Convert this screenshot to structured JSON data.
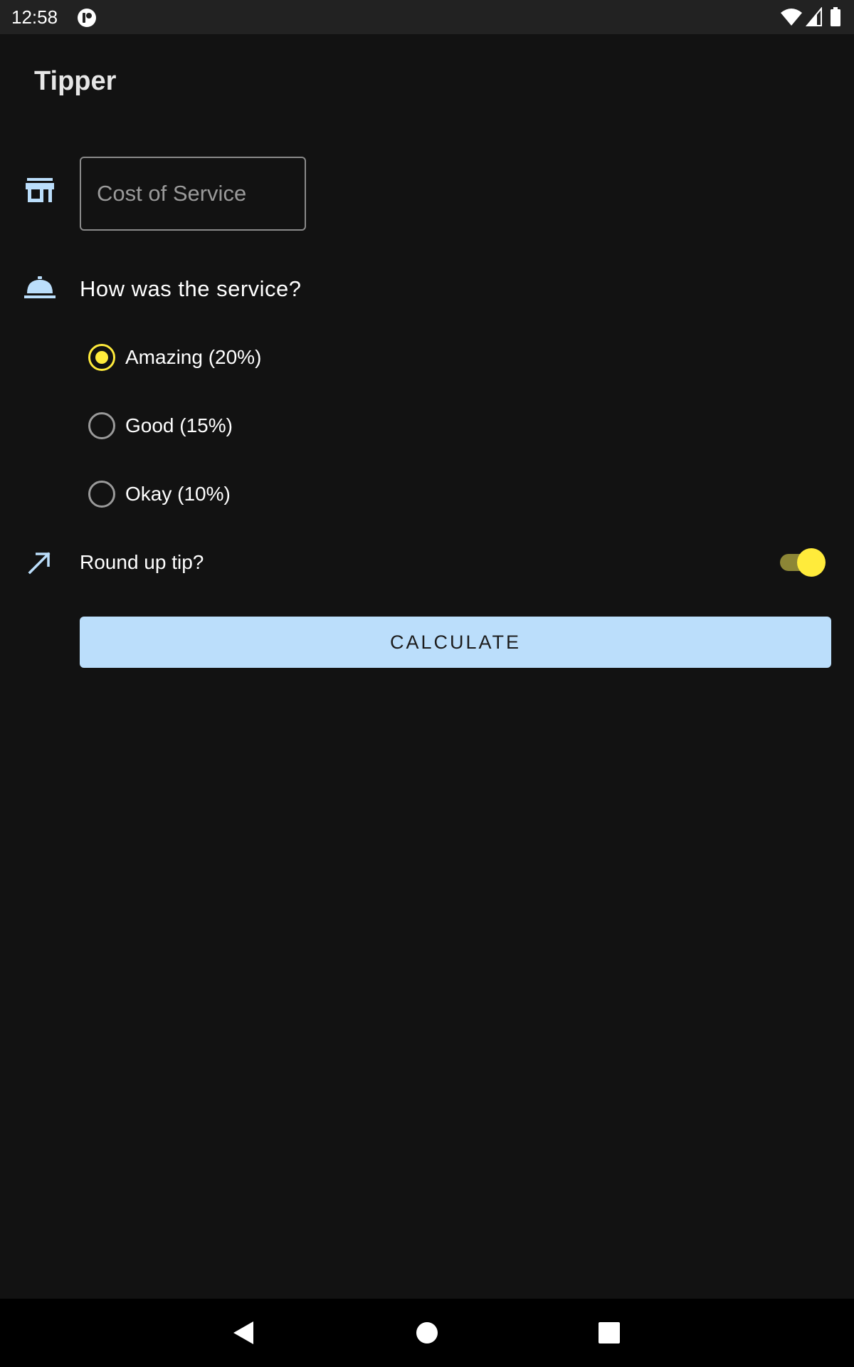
{
  "status_bar": {
    "time": "12:58",
    "icons": [
      "app-notification-icon",
      "wifi-icon",
      "signal-icon",
      "battery-icon"
    ]
  },
  "app": {
    "title": "Tipper"
  },
  "cost_field": {
    "placeholder": "Cost of Service",
    "value": "",
    "icon": "store-icon"
  },
  "service": {
    "question": "How was the service?",
    "icon": "room-service-bell-icon",
    "options": [
      {
        "label": "Amazing (20%)",
        "checked": true
      },
      {
        "label": "Good (15%)",
        "checked": false
      },
      {
        "label": "Okay (10%)",
        "checked": false
      }
    ]
  },
  "round_up": {
    "label": "Round up tip?",
    "icon": "arrow-up-right-icon",
    "enabled": true
  },
  "calculate_button": {
    "label": "CALCULATE"
  },
  "nav_bar": {
    "buttons": [
      "back-icon",
      "home-icon",
      "recents-icon"
    ]
  },
  "colors": {
    "background": "#121212",
    "accent": "#ffeb3b",
    "button": "#bbdefb",
    "icon": "#bbdefb"
  }
}
